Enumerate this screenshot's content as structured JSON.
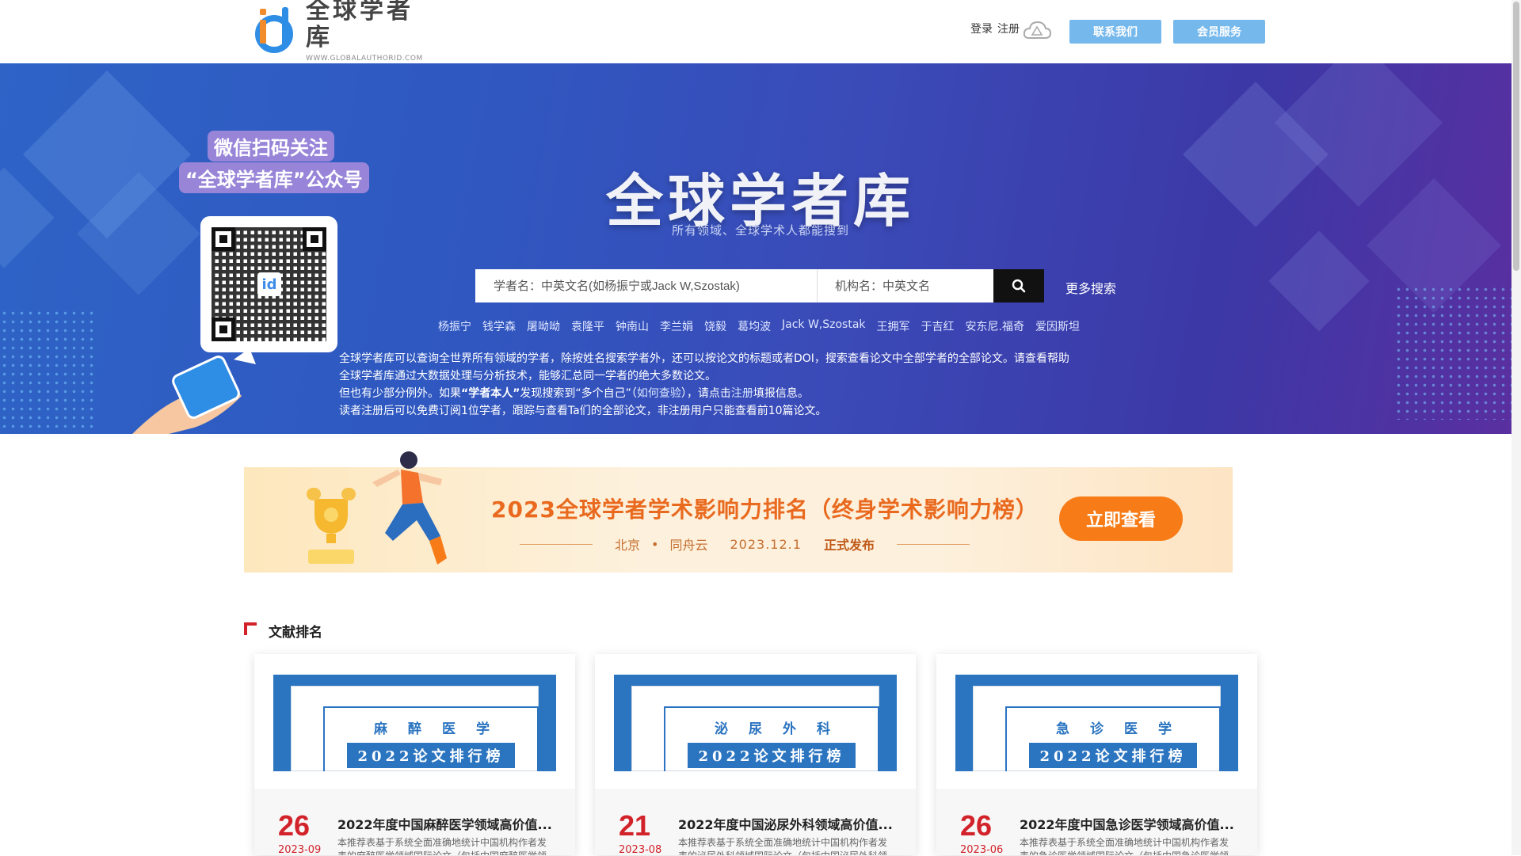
{
  "header": {
    "logo_title": "全球学者库",
    "logo_sub": "WWW.GLOBALAUTHORID.COM",
    "login": "登录",
    "register": "注册",
    "btn_contact": "联系我们",
    "btn_member": "会员服务"
  },
  "banner": {
    "wechat_line1": "微信扫码关注",
    "wechat_line2": "“全球学者库”公众号",
    "title": "全球学者库",
    "subtitle": "所有领域、全球学术人都能搜到",
    "search_scholar_placeholder": "学者名：中英文名(如杨振宁或Jack W,Szostak)",
    "search_org_placeholder": "机构名：中英文名",
    "more_search": "更多搜索",
    "hot_names": [
      "杨振宁",
      "钱学森",
      "屠呦呦",
      "袁隆平",
      "钟南山",
      "李兰娟",
      "饶毅",
      "葛均波",
      "Jack W,Szostak",
      "王拥军",
      "于吉红",
      "安东尼.福奇",
      "爱因斯坦"
    ],
    "info_1a": "全球学者库可以查询全世界所有领域的学者，除按姓名搜索学者外，还可以按论文的标题或者DOI，搜索查看论文中全部学者的全部论文。请查看",
    "info_1b": "帮助",
    "info_2": "全球学者库通过大数据处理与分析技术，能够汇总同一学者的绝大多数论文。",
    "info_3a": "但也有少部分例外。如果",
    "info_3b": "“学者本人”",
    "info_3c": "发现搜索到“多个自己”（",
    "info_3d": "如何查验",
    "info_3e": "），请点击",
    "info_3f": "注册",
    "info_3g": "填报信息。",
    "info_4": "读者注册后可以免费订阅1位学者，跟踪与查看Ta们的全部论文，非注册用户只能查看前10篇论文。"
  },
  "promo": {
    "title": "2023全球学者学术影响力排名（终身学术影响力榜）",
    "place": "北京",
    "dot": "•",
    "org": "同舟云",
    "date": "2023.12.1",
    "release": "正式发布",
    "button": "立即查看"
  },
  "section": {
    "title": "文献排名"
  },
  "cards": [
    {
      "field": "麻醉医学",
      "rank_label": "2022论文排行榜",
      "day": "26",
      "ym": "2023-09",
      "title": "2022年度中国麻醉医学领域高价值...",
      "desc": "本推荐表基于系统全面准确地统计中国机构作者发表的麻醉医学领域国际论文（包括中国麻醉医学领域"
    },
    {
      "field": "泌尿外科",
      "rank_label": "2022论文排行榜",
      "day": "21",
      "ym": "2023-08",
      "title": "2022年度中国泌尿外科领域高价值...",
      "desc": "本推荐表基于系统全面准确地统计中国机构作者发表的泌尿外科领域国际论文（包括中国泌尿外科领域"
    },
    {
      "field": "急诊医学",
      "rank_label": "2022论文排行榜",
      "day": "26",
      "ym": "2023-06",
      "title": "2022年度中国急诊医学领域高价值...",
      "desc": "本推荐表基于系统全面准确地统计中国机构作者发表的急诊医学领域国际论文（包括中国急诊医学领域"
    }
  ],
  "colors": {
    "accent_red": "#d2222a",
    "header_button": "#75b8ec",
    "promo_orange": "#f77c17"
  }
}
